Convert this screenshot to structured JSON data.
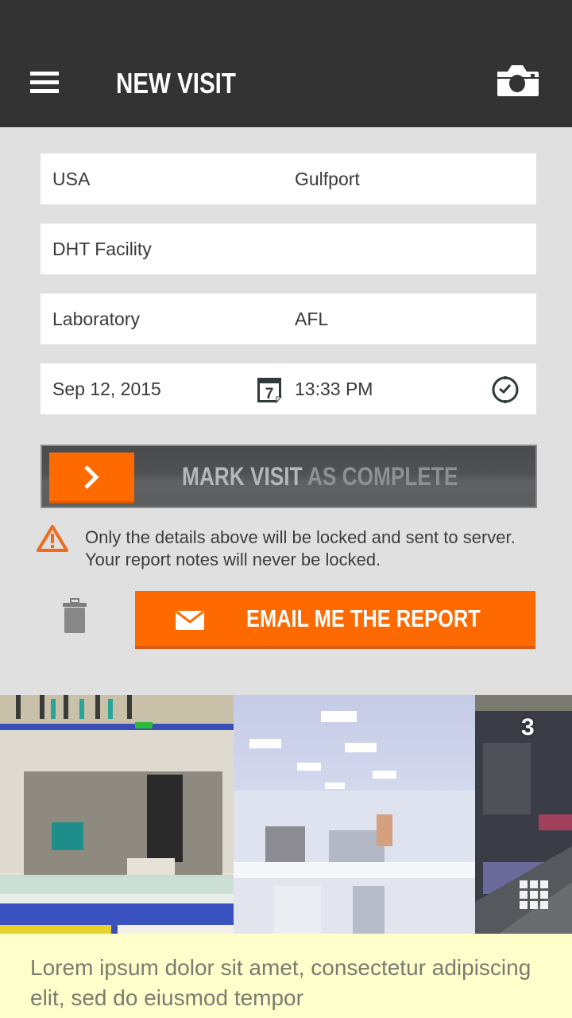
{
  "app_bar": {
    "title": "NEW VISIT",
    "menu_icon": "hamburger-menu-icon",
    "camera_icon": "camera-icon",
    "background": "#333333"
  },
  "form": {
    "country": "USA",
    "city": "Gulfport",
    "facility": "DHT Facility",
    "area": "Laboratory",
    "area_code": "AFL",
    "date": "Sep 12, 2015",
    "date_icon": "calendar-icon",
    "time": "13:33 PM",
    "time_icon": "clock-icon"
  },
  "mark_complete": {
    "label_strong": "MARK VISIT",
    "label_dim": "AS COMPLETE",
    "arrow_icon": "chevron-right-icon"
  },
  "warning": {
    "icon": "warning-triangle-icon",
    "text": "Only the details above will be locked and sent to server. Your report notes will never be locked."
  },
  "actions": {
    "delete_icon": "trash-icon",
    "email_label": "EMAIL ME THE REPORT",
    "email_icon": "envelope-icon"
  },
  "gallery": {
    "photo_count": "3",
    "grid_icon": "grid-icon",
    "photos": [
      "lab-bench-photo",
      "lab-room-photo",
      "lab-equipment-photo"
    ]
  },
  "notes": {
    "text": "Lorem ipsum dolor sit amet, consectetur adipiscing elit, sed do eiusmod tempor"
  },
  "colors": {
    "accent": "#ff6a00",
    "background": "#e0e0e0",
    "notes_background": "#ffffcc"
  }
}
